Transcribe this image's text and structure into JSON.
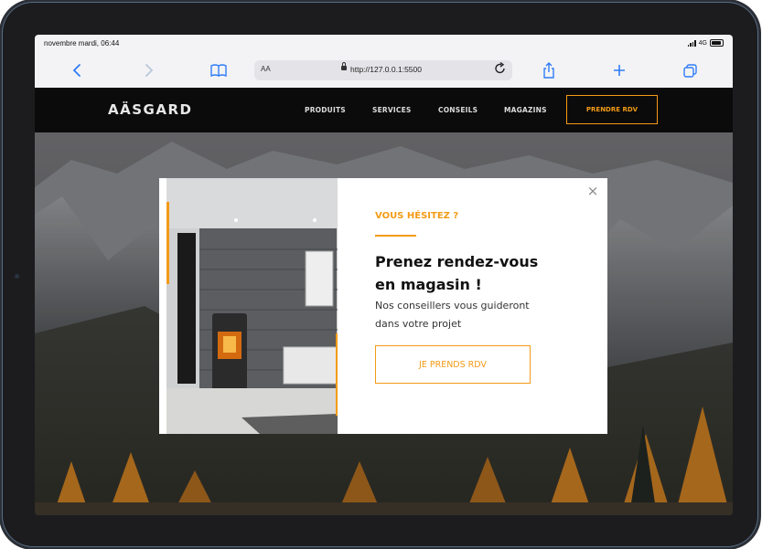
{
  "status_bar": {
    "time": "novembre mardi, 06:44",
    "network": "4G"
  },
  "toolbar": {
    "aa_label": "AA",
    "url": "http://127.0.0.1:5500"
  },
  "site": {
    "brand": "AÄSGARD",
    "nav": [
      "PRODUITS",
      "SERVICES",
      "CONSEILS",
      "MAGAZINS"
    ],
    "cta": "PRENDRE RDV"
  },
  "modal": {
    "eyebrow": "VOUS HÉSITEZ ?",
    "title_line1": "Prenez rendez-vous",
    "title_line2": "en magasin !",
    "desc_line1": "Nos conseillers vous guideront",
    "desc_line2": "dans votre projet",
    "button": "JE PRENDS RDV",
    "close_symbol": "×"
  },
  "colors": {
    "accent": "#f39b16",
    "nav_bg": "#0b0b0b",
    "toolbar_bg": "#f3f3f5",
    "link_blue": "#2f7cf6"
  },
  "icons": {
    "back": "chevron-left-icon",
    "forward": "chevron-right-icon",
    "bookmarks": "book-icon",
    "share": "share-icon",
    "new_tab": "plus-icon",
    "tabs": "tabs-icon",
    "reload": "reload-icon"
  }
}
